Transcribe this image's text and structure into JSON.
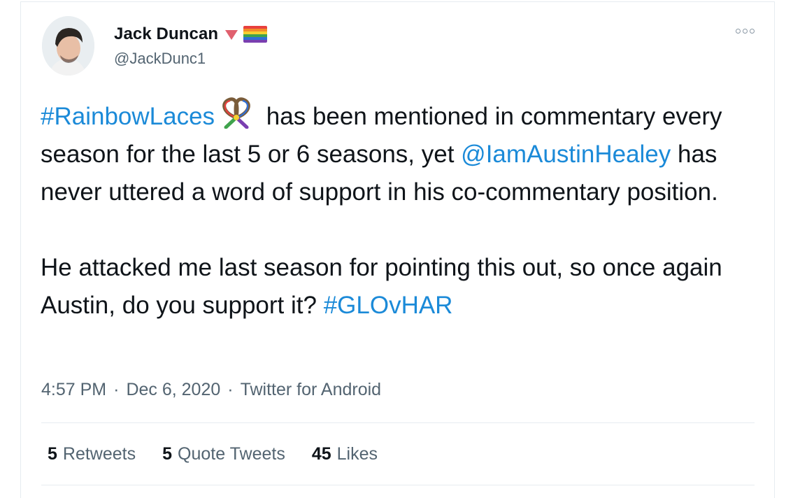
{
  "author": {
    "display_name": "Jack Duncan",
    "handle": "@JackDunc1",
    "badges": [
      "pink-triangle-icon",
      "rainbow-flag-icon"
    ],
    "avatar_icon": "avatar"
  },
  "tweet": {
    "hashtag_1": "#RainbowLaces",
    "emoji_icon": "rainbow-laces-icon",
    "line_1_rest": " has been mentioned in commentary every season for the last 5 or 6 seasons, yet ",
    "mention": "@IamAustinHealey",
    "line_2_rest": " has never uttered a word of support in his co-commentary position.",
    "para_2": "He attacked me last season for pointing this out, so once again Austin, do you support it? ",
    "hashtag_2": "#GLOvHAR"
  },
  "meta": {
    "time": "4:57 PM",
    "sep_1": "·",
    "date": "Dec 6, 2020",
    "sep_2": "·",
    "source": "Twitter for Android"
  },
  "stats": {
    "retweets_count": "5",
    "retweets_label": "Retweets",
    "quotes_count": "5",
    "quotes_label": "Quote Tweets",
    "likes_count": "45",
    "likes_label": "Likes"
  },
  "colors": {
    "link": "#1b8ad8",
    "muted": "#536471",
    "triangle": "#e0606e",
    "rainbow": [
      "#e8403e",
      "#f28c28",
      "#f5d030",
      "#3fa34d",
      "#2f6fd6",
      "#7a3fb0"
    ]
  }
}
